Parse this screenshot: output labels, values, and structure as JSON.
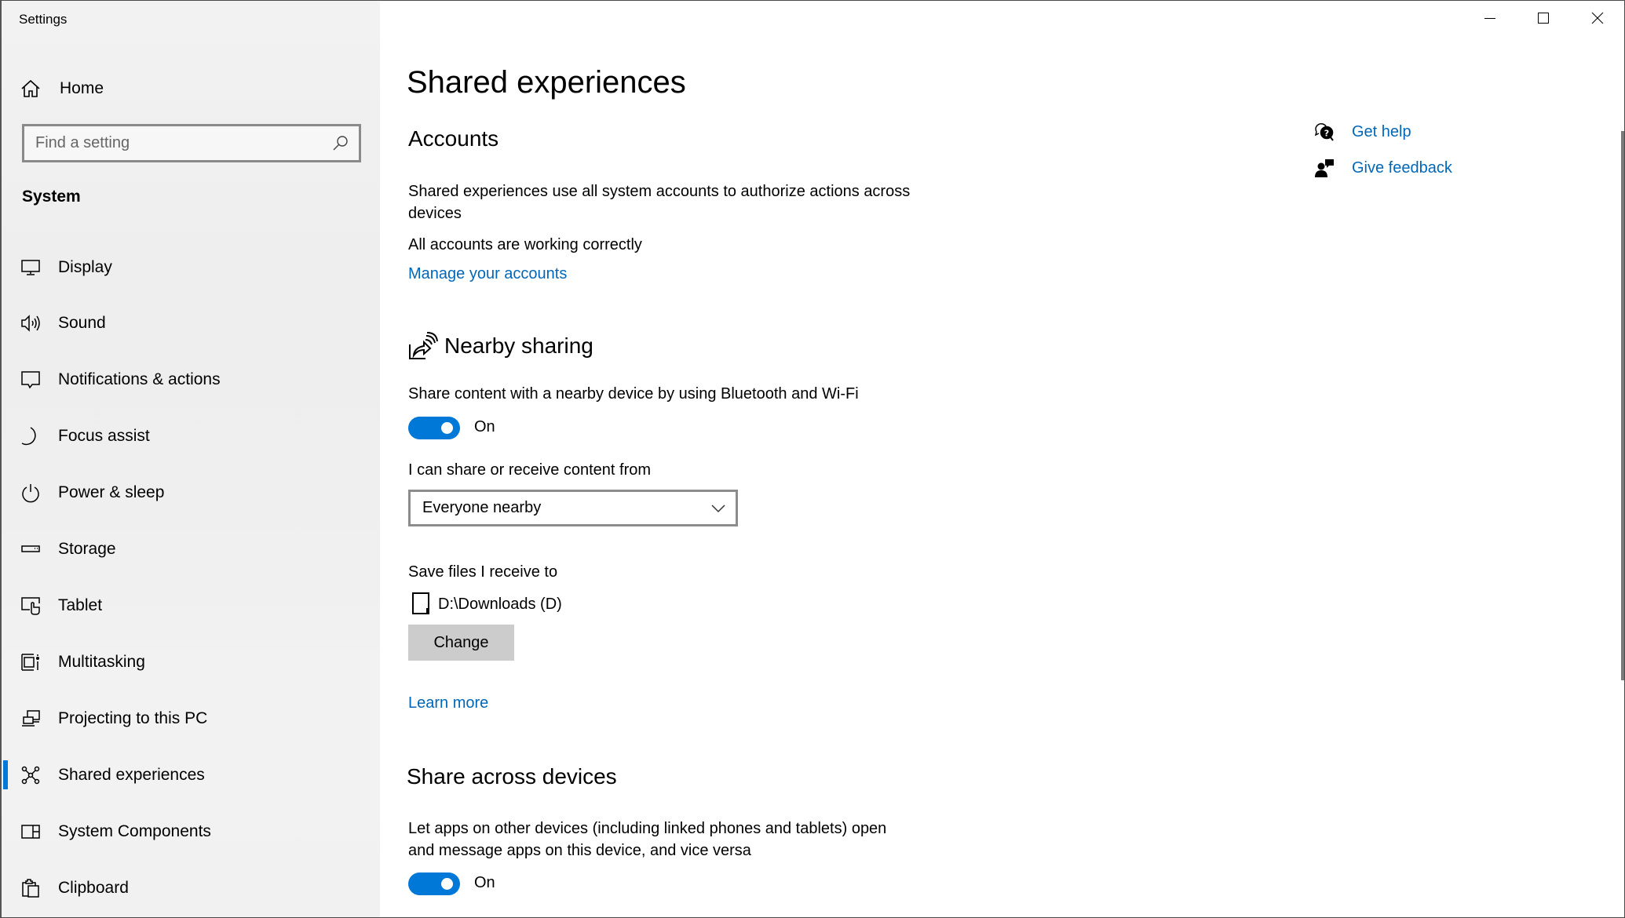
{
  "window": {
    "title": "Settings",
    "controls": {
      "minimize": "minimize",
      "maximize": "maximize",
      "close": "close"
    }
  },
  "sidebar": {
    "home_label": "Home",
    "search": {
      "placeholder": "Find a setting",
      "value": ""
    },
    "section_label": "System",
    "items": [
      {
        "label": "Display",
        "icon": "display-icon"
      },
      {
        "label": "Sound",
        "icon": "sound-icon"
      },
      {
        "label": "Notifications & actions",
        "icon": "notifications-icon"
      },
      {
        "label": "Focus assist",
        "icon": "moon-icon"
      },
      {
        "label": "Power & sleep",
        "icon": "power-icon"
      },
      {
        "label": "Storage",
        "icon": "storage-icon"
      },
      {
        "label": "Tablet",
        "icon": "tablet-icon"
      },
      {
        "label": "Multitasking",
        "icon": "multitasking-icon"
      },
      {
        "label": "Projecting to this PC",
        "icon": "projecting-icon"
      },
      {
        "label": "Shared experiences",
        "icon": "shared-experiences-icon",
        "active": true
      },
      {
        "label": "System Components",
        "icon": "system-components-icon"
      },
      {
        "label": "Clipboard",
        "icon": "clipboard-icon"
      }
    ]
  },
  "main": {
    "page_title": "Shared experiences",
    "accounts": {
      "heading": "Accounts",
      "description_line1": "Shared experiences use all system accounts to authorize actions across",
      "description_line2": "devices",
      "status": "All accounts are working correctly",
      "manage_link": "Manage your accounts"
    },
    "nearby_sharing": {
      "heading": "Nearby sharing",
      "toggle_description": "Share content with a nearby device by using Bluetooth and Wi-Fi",
      "toggle_state": "On",
      "toggle_on": true,
      "share_from_label": "I can share or receive content from",
      "share_from_value": "Everyone nearby",
      "save_label": "Save files I receive to",
      "save_path": "D:\\Downloads (D)",
      "change_button": "Change",
      "learn_more": "Learn more"
    },
    "share_across_devices": {
      "heading": "Share across devices",
      "description_line1": "Let apps on other devices (including linked phones and tablets) open",
      "description_line2": "and message apps on this device, and vice versa",
      "toggle_state": "On",
      "toggle_on": true
    },
    "help": {
      "get_help": "Get help",
      "give_feedback": "Give feedback"
    }
  },
  "colors": {
    "accent": "#0078d7",
    "link": "#0067b8",
    "button_bg": "#cccccc",
    "sidebar_bg": "#f0f0f0"
  }
}
